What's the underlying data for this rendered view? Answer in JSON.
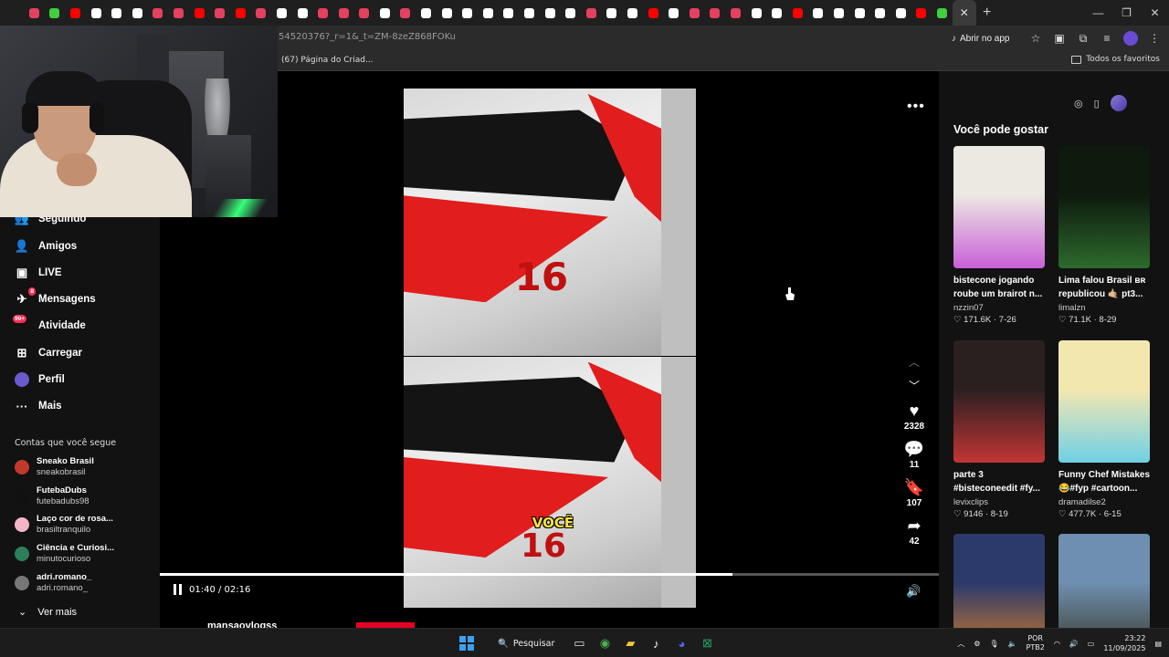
{
  "browser": {
    "url": "54520376?_r=1&_t=ZM-8zeZ868FOKu",
    "open_app_label": "Abrir no app",
    "bookmark_item": "(67) Página do Criad...",
    "bookmarks_all": "Todos os favoritos",
    "tab_colors": [
      "#e4405f",
      "#3fcf3f",
      "#ff0000",
      "#ffffff",
      "#ffffff",
      "#ffffff",
      "#e4405f",
      "#e4405f",
      "#ff0000",
      "#e4405f",
      "#ff0000",
      "#e4405f",
      "#ffffff",
      "#ffffff",
      "#e4405f",
      "#e4405f",
      "#e4405f",
      "#ffffff",
      "#e4405f",
      "#ffffff",
      "#ffffff",
      "#ffffff",
      "#ffffff",
      "#ffffff",
      "#ffffff",
      "#ffffff",
      "#ffffff",
      "#e4405f",
      "#ffffff",
      "#ffffff",
      "#ff0000",
      "#ffffff",
      "#e4405f",
      "#e4405f",
      "#e4405f",
      "#ffffff",
      "#ffffff",
      "#ff0000",
      "#ffffff",
      "#ffffff",
      "#ffffff",
      "#ffffff",
      "#ffffff",
      "#ff0000",
      "#3fcf3f"
    ]
  },
  "sidebar": {
    "items": [
      {
        "label": "Seguindo",
        "icon": "following-icon"
      },
      {
        "label": "Amigos",
        "icon": "friends-icon"
      },
      {
        "label": "LIVE",
        "icon": "live-icon"
      },
      {
        "label": "Mensagens",
        "icon": "messages-icon",
        "badge": "8"
      },
      {
        "label": "Atividade",
        "icon": "activity-icon",
        "badge": "99+"
      },
      {
        "label": "Carregar",
        "icon": "upload-icon"
      },
      {
        "label": "Perfil",
        "icon": "profile-avatar"
      },
      {
        "label": "Mais",
        "icon": "more-icon"
      }
    ],
    "section_title": "Contas que você segue",
    "following": [
      {
        "name": "Sneako Brasil",
        "username": "sneakobrasil",
        "color": "#c0392b"
      },
      {
        "name": "FutebaDubs",
        "username": "futebadubs98",
        "color": "#111111"
      },
      {
        "name": "Laço cor de rosa...",
        "username": "brasiltranquilo",
        "color": "#f3b6c8"
      },
      {
        "name": "Ciência e Curiosi...",
        "username": "minutocurioso",
        "color": "#2e7d5b"
      },
      {
        "name": "adri.romano_",
        "username": "adri.romano_",
        "color": "#777777"
      }
    ],
    "see_more": "Ver mais"
  },
  "video": {
    "caption": "VOCÊ",
    "car_number": "16",
    "counts": {
      "likes": "2328",
      "comments": "11",
      "saves": "107",
      "shares": "42"
    },
    "time": "01:40 / 02:16",
    "progress": 0.735,
    "author_peek": "mansaovlogss"
  },
  "recommend": {
    "title": "Você pode gostar",
    "cards": [
      {
        "title": "bistecone jogando",
        "title2": "roube um brairot n...",
        "user": "nzzin07",
        "meta": "♡ 171.6K · 7-26",
        "c1": "#ece8e2",
        "c2": "#c95fd8"
      },
      {
        "title": "Lima falou Brasil ʙʀ",
        "title2": "republicou 🤙🏼 pt3...",
        "user": "limalzn",
        "meta": "♡ 71.1K · 8-29",
        "c1": "#0d1a0d",
        "c2": "#2d6b2d"
      },
      {
        "title": "parte 3",
        "title2": "#bisteconeedit #fy...",
        "user": "levixclips",
        "meta": "♡ 9146 · 8-19",
        "c1": "#2a2020",
        "c2": "#c23535"
      },
      {
        "title": "Funny Chef Mistakes",
        "title2": "😂#fyp #cartoon...",
        "user": "dramadilse2",
        "meta": "♡ 477.7K · 6-15",
        "c1": "#f3e7b0",
        "c2": "#6fd0e6"
      },
      {
        "title": "",
        "title2": "",
        "user": "",
        "meta": "",
        "c1": "#2b3a6b",
        "c2": "#d07a2b"
      },
      {
        "title": "",
        "title2": "",
        "user": "",
        "meta": "",
        "c1": "#6e8fb0",
        "c2": "#3b3b2b"
      }
    ]
  },
  "taskbar": {
    "search_label": "Pesquisar",
    "lang_top": "POR",
    "lang_bottom": "PTB2",
    "time": "23:22",
    "date": "11/09/2025"
  }
}
